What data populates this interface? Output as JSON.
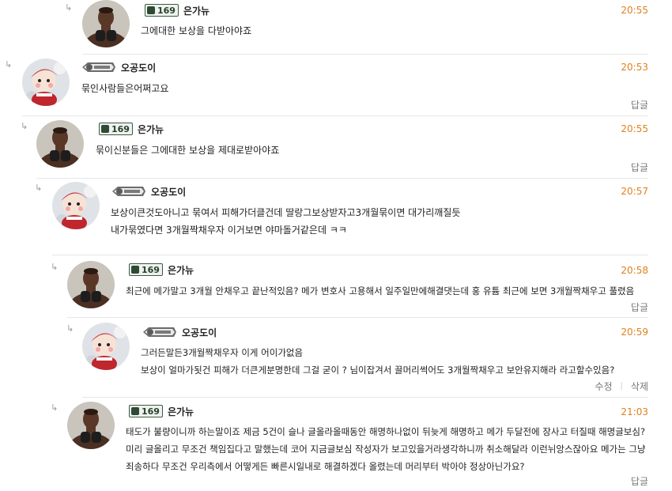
{
  "level_badge": "169",
  "comments": [
    {
      "nickname": "은가뉴",
      "time": "20:55",
      "lines": [
        "그에대한 보상을 다받아야죠"
      ],
      "actions": []
    },
    {
      "nickname": "오공도이",
      "time": "20:53",
      "lines": [
        "묶인사람들은어쩌고요"
      ],
      "actions": [
        "답글"
      ]
    },
    {
      "nickname": "은가뉴",
      "time": "20:55",
      "lines": [
        "묶이신분들은 그에대한 보상을 제대로받아야죠"
      ],
      "actions": [
        "답글"
      ]
    },
    {
      "nickname": "오공도이",
      "time": "20:57",
      "lines": [
        "보상이큰것도아니고 묶여서 피해가더클건데 딸랑그보상받자고3개월묶이면 대가리깨질듯",
        "내가묶였다면 3개월짝채우자 이거보면 야마돌거같은데 ㅋㅋ"
      ],
      "actions": []
    },
    {
      "nickname": "은가뉴",
      "time": "20:58",
      "lines": [
        "최근에 메가말고 3개월 안채우고 끝난적있음? 메가 변호사 고용해서 일주일만에해결댓는데 홍 유튬 최근에 보면 3개월짝채우고 풀렸음"
      ],
      "actions": [
        "답글"
      ]
    },
    {
      "nickname": "오공도이",
      "time": "20:59",
      "lines": [
        "그러든말든3개월짝채우자 이게 어이가없음",
        "보상이 얼마가됫건 피해가 더큰게분명한데 그걸 굳이 ? 님이잡겨서 끌머리썩어도 3개월짝채우고 보안유지해라 라고할수있음?"
      ],
      "actions": [
        "수정",
        "삭제"
      ]
    },
    {
      "nickname": "은가뉴",
      "time": "21:03",
      "lines": [
        "태도가 불량이니까 하는말이죠 제금 5건이 슬나 글올라올때동안 해명하나없이 뒤늦게 해명하고 메가 두달전에 장사고 터질때 해명글보심? 미리 글올리고 무조건 책임집다고 말했는데 코어 지금글보심 작성자가 보고있을거라생각하니까 취소해달라 이런뉘앙스잖아요 메가는 그냥 죄송하다 무조건 우리측에서 어떻게든 빠른시일내로 해결하겠다 올렸는데 머리부터 박아야 정상아닌가요?"
      ],
      "actions": [
        "답글"
      ]
    }
  ]
}
